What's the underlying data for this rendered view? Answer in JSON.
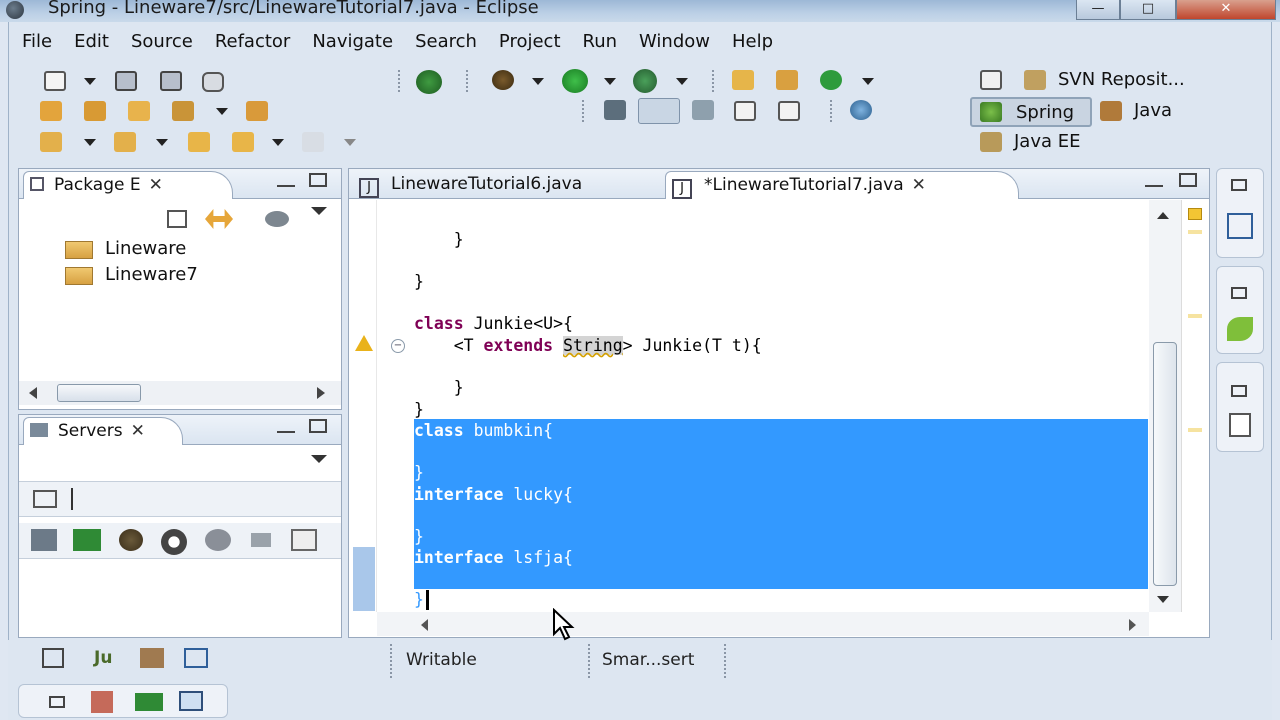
{
  "window": {
    "title": "Spring - Lineware7/src/LinewareTutorial7.java - Eclipse",
    "minimize": "—",
    "maximize": "□",
    "close": "✕"
  },
  "menu": [
    "File",
    "Edit",
    "Source",
    "Refactor",
    "Navigate",
    "Search",
    "Project",
    "Run",
    "Window",
    "Help"
  ],
  "perspectives": {
    "svn": "SVN Reposit...",
    "spring": "Spring",
    "java": "Java",
    "javaee": "Java EE"
  },
  "package_explorer": {
    "tab": "Package E",
    "projects": [
      "Lineware",
      "Lineware7"
    ]
  },
  "servers": {
    "tab": "Servers"
  },
  "editor": {
    "tabs": [
      "LinewareTutorial6.java",
      "*LinewareTutorial7.java"
    ],
    "code": {
      "l1": "    }",
      "l2": "}",
      "l3_kw": "class",
      "l3_rest": " Junkie<U>{",
      "l4_pre": "    <T ",
      "l4_kw": "extends",
      "l4_sp": " ",
      "l4_hl": "String",
      "l4_rest": "> Junkie(T t){",
      "l5": "    }",
      "l6": "}",
      "l7_kw": "class",
      "l7_rest": " bumbkin{",
      "l8": "}",
      "l9_kw": "interface",
      "l9_rest": " lucky{",
      "l10": "}",
      "l11_kw": "interface",
      "l11_rest": " lsfja{",
      "l12": "}"
    }
  },
  "status": {
    "writable": "Writable",
    "insert_mode": "Smar...sert"
  },
  "colors": {
    "selection": "#3399ff",
    "keyword": "#7f0055",
    "frame": "#dde6f1"
  }
}
